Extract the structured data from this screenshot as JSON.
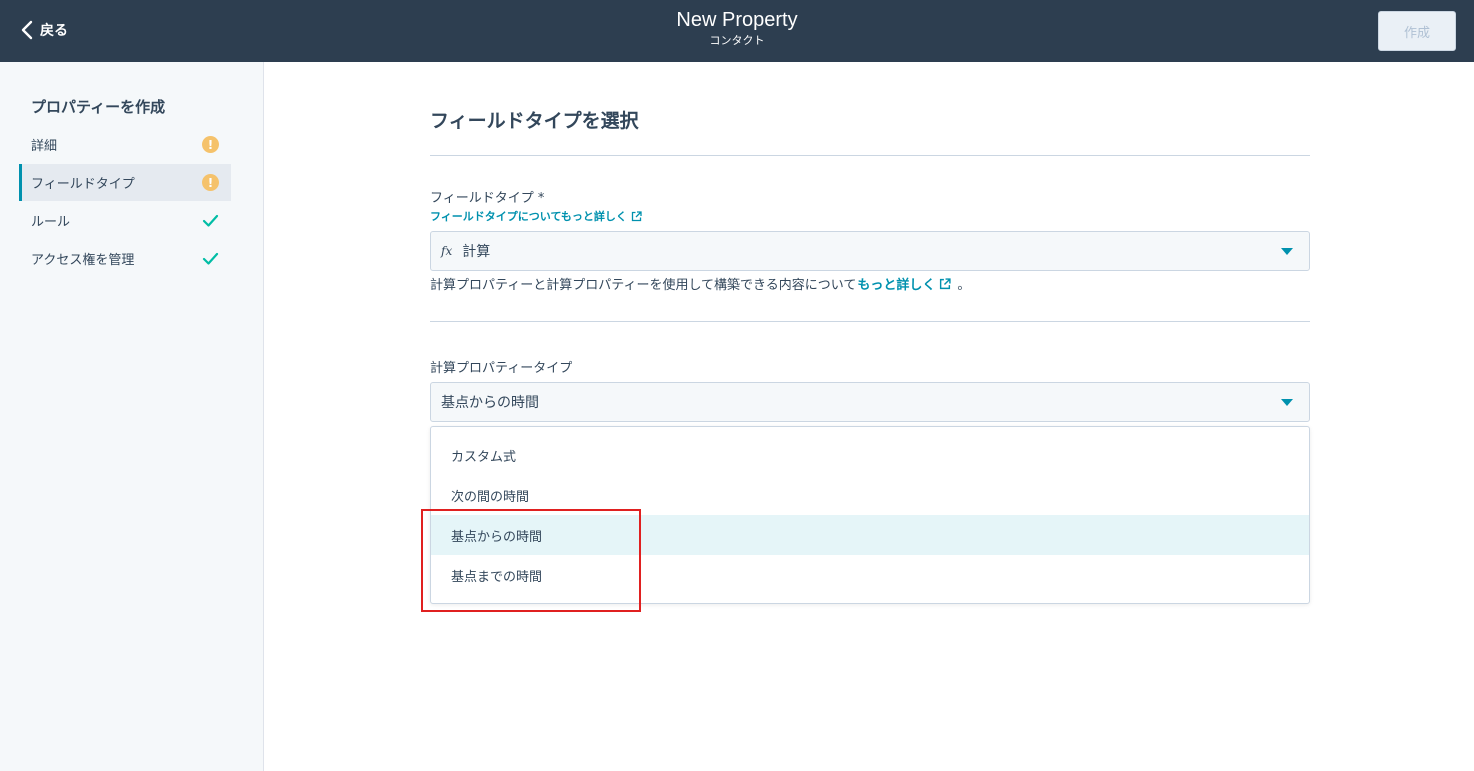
{
  "header": {
    "back_label": "戻る",
    "title": "New Property",
    "subtitle": "コンタクト",
    "create_label": "作成"
  },
  "sidebar": {
    "title": "プロパティーを作成",
    "items": [
      {
        "label": "詳細",
        "status": "warning"
      },
      {
        "label": "フィールドタイプ",
        "status": "warning",
        "active": true
      },
      {
        "label": "ルール",
        "status": "complete"
      },
      {
        "label": "アクセス権を管理",
        "status": "complete"
      }
    ],
    "warning_glyph": "!"
  },
  "main": {
    "heading": "フィールドタイプを選択",
    "field_type_label": "フィールドタイプ *",
    "field_type_link": "フィールドタイプについてもっと詳しく",
    "field_type_icon": "fx",
    "field_type_value": "計算",
    "help_text": "計算プロパティーと計算プロパティーを使用して構築できる内容について",
    "help_link": "もっと詳しく",
    "help_end": "。",
    "calc_type_label": "計算プロパティータイプ",
    "calc_type_value": "基点からの時間",
    "options": [
      "カスタム式",
      "次の間の時間",
      "基点からの時間",
      "基点までの時間"
    ],
    "highlighted_option": "基点からの時間"
  },
  "colors": {
    "header_bg": "#2d3e50",
    "accent": "#0091ae",
    "warning": "#f5c26b",
    "success": "#00bda5",
    "annotation": "#e02020"
  }
}
